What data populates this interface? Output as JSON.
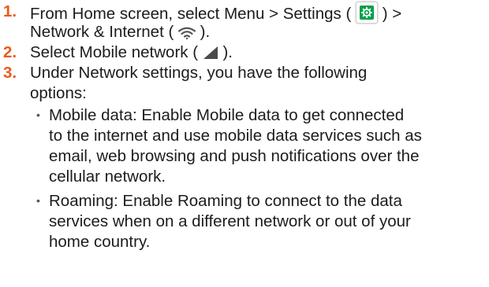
{
  "steps": [
    {
      "number": "1.",
      "line1_a": "From Home screen, select Menu  > Settings  ( ",
      "line1_b": " ) >",
      "line2_a": "Network & Internet ( ",
      "line2_b": " )."
    },
    {
      "number": "2.",
      "line1_a": "Select Mobile network ( ",
      "line1_b": " )."
    },
    {
      "number": "3.",
      "line1": "Under Network settings, you have the following",
      "line2": "options:"
    }
  ],
  "bullets": [
    {
      "symbol": "•",
      "lines": [
        "Mobile data: Enable Mobile data to get connected",
        "to the internet and use mobile data services such as",
        "email, web browsing and push notifications over the",
        "cellular network."
      ]
    },
    {
      "symbol": "•",
      "lines": [
        "Roaming: Enable Roaming to connect to the data",
        "services when on a different network or out of your",
        "home country."
      ]
    }
  ],
  "icons": {
    "settings": "settings-gear-icon",
    "wifi": "wifi-icon",
    "signal": "mobile-signal-icon"
  },
  "colors": {
    "step_number": "#e85b1c",
    "settings_icon_bg": "#00a14b",
    "text": "#1c1c1c"
  }
}
